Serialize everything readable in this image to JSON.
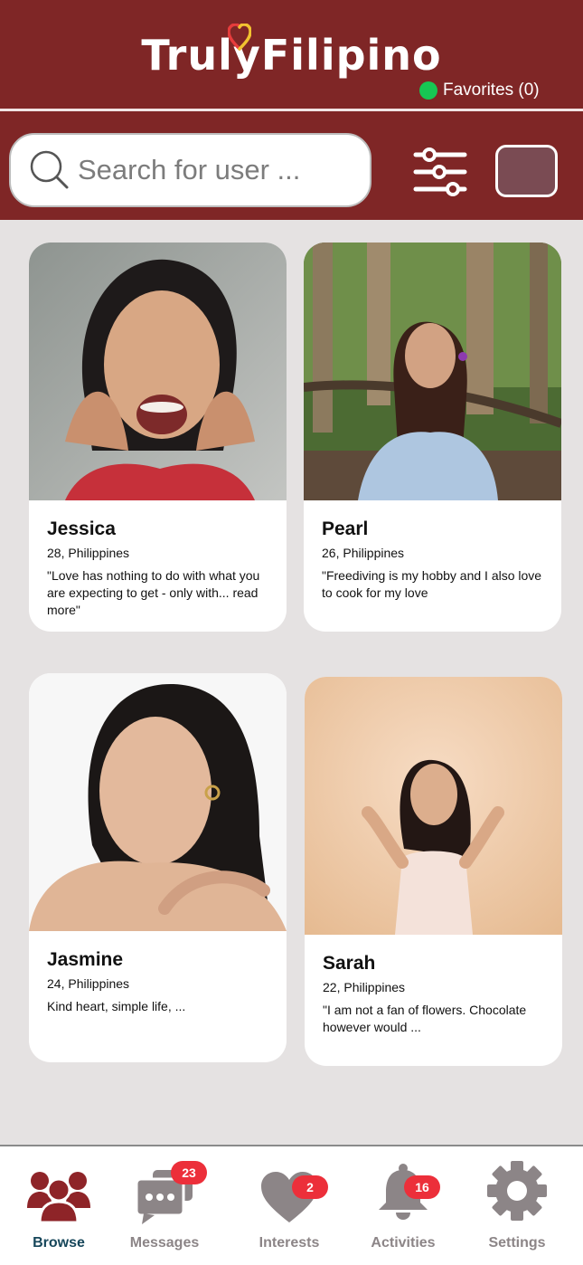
{
  "brand": {
    "name": "TrulyFilipino"
  },
  "header": {
    "favorites_label": "Favorites (0)"
  },
  "search": {
    "placeholder": "Search for user ..."
  },
  "profiles": [
    {
      "name": "Jessica",
      "info": "28, Philippines",
      "bio": "\"Love has nothing to do with what you are expecting to get - only with... read more\""
    },
    {
      "name": "Pearl",
      "info": "26, Philippines",
      "bio": "\"Freediving is my hobby and I also love to cook for my love"
    },
    {
      "name": "Jasmine",
      "info": "24, Philippines",
      "bio": "Kind heart, simple life, ..."
    },
    {
      "name": "Sarah",
      "info": "22, Philippines",
      "bio": "\"I am not a fan of flowers. Chocolate however would ..."
    }
  ],
  "nav": {
    "browse": {
      "label": "Browse"
    },
    "messages": {
      "label": "Messages",
      "badge": "23"
    },
    "interests": {
      "label": "Interests",
      "badge": "2"
    },
    "activities": {
      "label": "Activities",
      "badge": "16"
    },
    "settings": {
      "label": "Settings"
    }
  },
  "colors": {
    "header_bg": "#7f2626",
    "page_bg": "#e5e2e2",
    "online_dot": "#17c653",
    "badge": "#ec2f3a",
    "active_nav": "#16465a",
    "inactive_nav": "#8c8587"
  },
  "icons": [
    "heart-logo-icon",
    "search-icon",
    "filter-sliders-icon",
    "browse-users-icon",
    "messages-icon",
    "heart-icon",
    "bell-icon",
    "gear-icon"
  ]
}
